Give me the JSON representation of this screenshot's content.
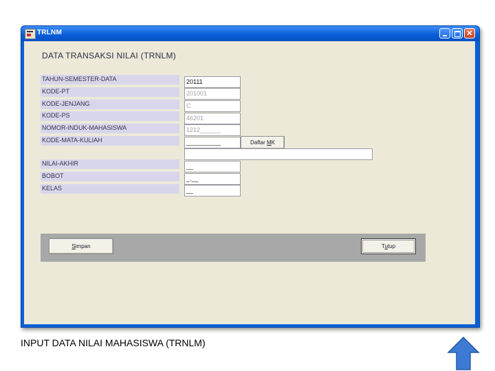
{
  "window": {
    "title": "TRLNM"
  },
  "form": {
    "title": "DATA TRANSAKSI NILAI (TRNLM)",
    "rows": [
      {
        "label": "TAHUN-SEMESTER-DATA",
        "value": "20111"
      },
      {
        "label": "KODE-PT",
        "value": "201001"
      },
      {
        "label": "KODE-JENJANG",
        "value": "C"
      },
      {
        "label": "KODE-PS",
        "value": "46201"
      },
      {
        "label": "NOMOR-INDUK-MAHASISWA",
        "value": "1212______"
      },
      {
        "label": "KODE-MATA-KULIAH",
        "value": "__________"
      },
      {
        "label": "NILAI-AKHIR",
        "value": "__"
      },
      {
        "label": "BOBOT",
        "value": "_.__"
      },
      {
        "label": "KELAS",
        "value": "__"
      }
    ],
    "kode_mk_description": "",
    "daftar_mk": {
      "prefix": "Daftar ",
      "accel": "M",
      "suffix": "K"
    }
  },
  "actions": {
    "simpan": {
      "accel": "S",
      "rest": "impan"
    },
    "tutup": {
      "prefix": "T",
      "accel": "u",
      "rest": "tup"
    }
  },
  "caption": "INPUT DATA NILAI MAHASISWA (TRNLM)",
  "icons": {
    "up_arrow": "up-arrow-icon",
    "up_arrow_color": "#3d7ad4"
  }
}
